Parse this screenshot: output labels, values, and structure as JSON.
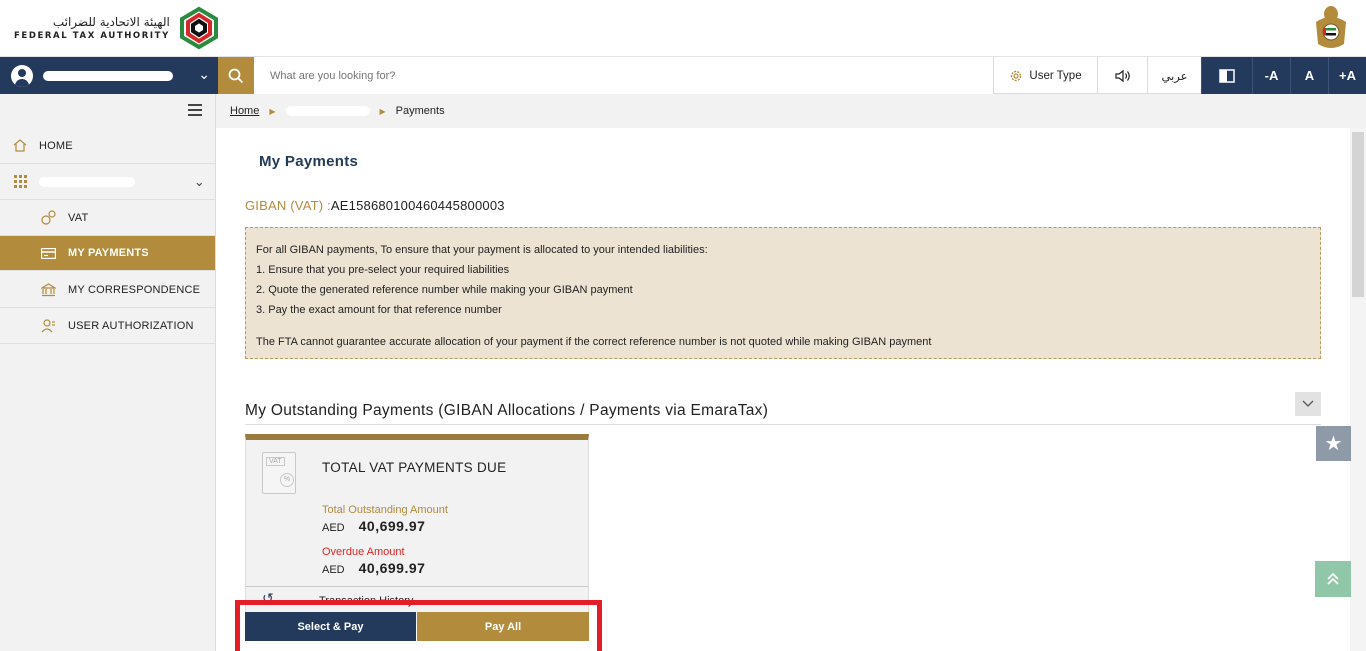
{
  "header": {
    "logo_ar": "الهيئة الاتحادية للضرائب",
    "logo_en": "FEDERAL TAX AUTHORITY"
  },
  "navbar": {
    "search_placeholder": "What are you looking for?",
    "user_type_label": "User Type",
    "arabic_label": "عربي",
    "font_decrease": "-A",
    "font_normal": "A",
    "font_increase": "+A"
  },
  "sidebar": {
    "items": [
      {
        "label": "HOME",
        "icon": "home-icon"
      },
      {
        "label": "",
        "icon": "grid-icon"
      },
      {
        "label": "VAT",
        "icon": "vat-icon"
      },
      {
        "label": "MY PAYMENTS",
        "icon": "payments-icon"
      },
      {
        "label": "MY CORRESPONDENCE",
        "icon": "bank-icon"
      },
      {
        "label": "USER AUTHORIZATION",
        "icon": "user-auth-icon"
      }
    ]
  },
  "breadcrumb": {
    "home": "Home",
    "current": "Payments"
  },
  "main": {
    "title": "My Payments",
    "giban_label": "GIBAN (VAT) :",
    "giban_value": "AE158680100460445800003",
    "notice": {
      "line1": "For all GIBAN payments, To ensure that your payment is allocated to your intended liabilities:",
      "line2": "1. Ensure that you pre-select your required liabilities",
      "line3": "2. Quote the generated reference number while making your GIBAN payment",
      "line4": "3. Pay the exact amount for that reference number",
      "line5": "The FTA cannot guarantee accurate allocation of your payment if the correct reference number is not quoted while making GIBAN payment"
    },
    "section_title": "My Outstanding Payments (GIBAN Allocations / Payments via EmaraTax)",
    "card": {
      "icon_tag": "VAT",
      "icon_pct": "%",
      "title": "TOTAL VAT PAYMENTS DUE",
      "outstanding_label": "Total Outstanding Amount",
      "outstanding_currency": "AED",
      "outstanding_value": "40,699.97",
      "overdue_label": "Overdue Amount",
      "overdue_currency": "AED",
      "overdue_value": "40,699.97",
      "history_label": "Transaction History"
    },
    "buttons": {
      "select_pay": "Select & Pay",
      "pay_all": "Pay All"
    }
  },
  "colors": {
    "navy": "#233a5c",
    "gold": "#b28b3d",
    "highlight_red": "#e41e26",
    "overdue_red": "#e32424"
  }
}
